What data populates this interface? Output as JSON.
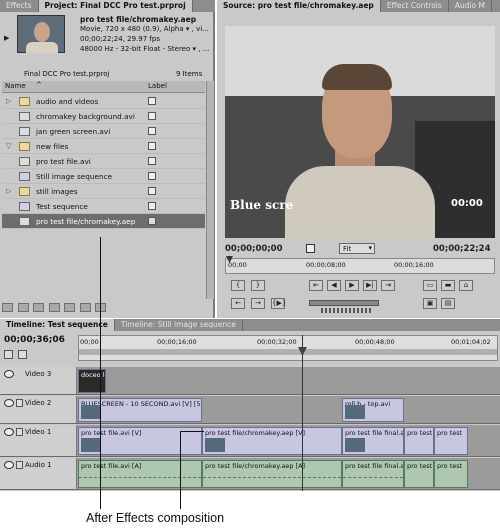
{
  "project_panel": {
    "tabs": [
      "Effects",
      "Project: Final DCC Pro test.prproj"
    ],
    "preview": {
      "name": "pro test file/chromakey.aep",
      "line1": "Movie, 720 x 480 (0.9), Alpha ▾ , vi...",
      "line2": "00;00;22;24, 29.97 fps",
      "line3": "48000 Hz - 32-bit Float - Stereo ▾ , ..."
    },
    "project_file": "Final DCC Pro test.prproj",
    "item_count": "9 Items",
    "columns": {
      "name": "Name",
      "label": "Label"
    },
    "items": [
      {
        "name": "audio and videos",
        "type": "folder",
        "twirl": "▷"
      },
      {
        "name": "chromakey background.avi",
        "type": "clip",
        "twirl": ""
      },
      {
        "name": "jan green screen.avi",
        "type": "clip",
        "twirl": ""
      },
      {
        "name": "new files",
        "type": "folder",
        "twirl": "▽"
      },
      {
        "name": "pro test file.avi",
        "type": "clip",
        "twirl": ""
      },
      {
        "name": "Still image sequence",
        "type": "seq",
        "twirl": ""
      },
      {
        "name": "still images",
        "type": "folder",
        "twirl": "▷"
      },
      {
        "name": "Test sequence",
        "type": "seq",
        "twirl": ""
      },
      {
        "name": "pro test file/chromakey.aep",
        "type": "clip",
        "twirl": "",
        "selected": true
      }
    ]
  },
  "monitor": {
    "tabs": [
      "Source: pro test file/chromakey.aep",
      "Effect Controls",
      "Audio M"
    ],
    "caption_overlay": "Blue scre",
    "caption_timecode": "00:00",
    "current_time": "00;00;00;00",
    "fit": "Fit",
    "duration": "00;00;22;24",
    "ruler": [
      "00;00",
      "00;00;08;00",
      "00;00;16;00"
    ]
  },
  "timeline": {
    "tabs": [
      "Timeline: Test sequence",
      "Timeline: Still image sequence"
    ],
    "current_time": "00;00;36;06",
    "ruler": [
      "00;00",
      "00;00;16;00",
      "00;00;32;00",
      "00;00;48;00",
      "00;01;04;02"
    ],
    "tracks": [
      {
        "name": "Video 3",
        "clips": [
          {
            "label": "doceo lo"
          }
        ]
      },
      {
        "name": "Video 2",
        "clips": [
          {
            "label": "BLUESCREEN - 10 SECOND.avi [V] [50"
          },
          {
            "label": "roll b - top.avi"
          }
        ]
      },
      {
        "name": "Video 1",
        "clips": [
          {
            "label": "pro test file.avi [V]"
          },
          {
            "label": "pro test file/chromakey.aep [V]"
          },
          {
            "label": "pro test file final.a"
          },
          {
            "label": "pro test"
          },
          {
            "label": "pro test"
          }
        ]
      },
      {
        "name": "Audio 1",
        "clips": [
          {
            "label": "pro test file.avi [A]"
          },
          {
            "label": "pro test file/chromakey.aep [A]"
          },
          {
            "label": "pro test file final.a"
          },
          {
            "label": "pro test"
          },
          {
            "label": "pro test"
          }
        ]
      }
    ]
  },
  "callout": "After Effects composition",
  "colors": {
    "panel": "#c9c9c9",
    "tabbar": "#8d8d8d",
    "selection": "#6d6d6d",
    "video_clip": "#c7c7e2",
    "audio_clip": "#aec8b0",
    "monitor_bg": "#2a2a2a"
  }
}
